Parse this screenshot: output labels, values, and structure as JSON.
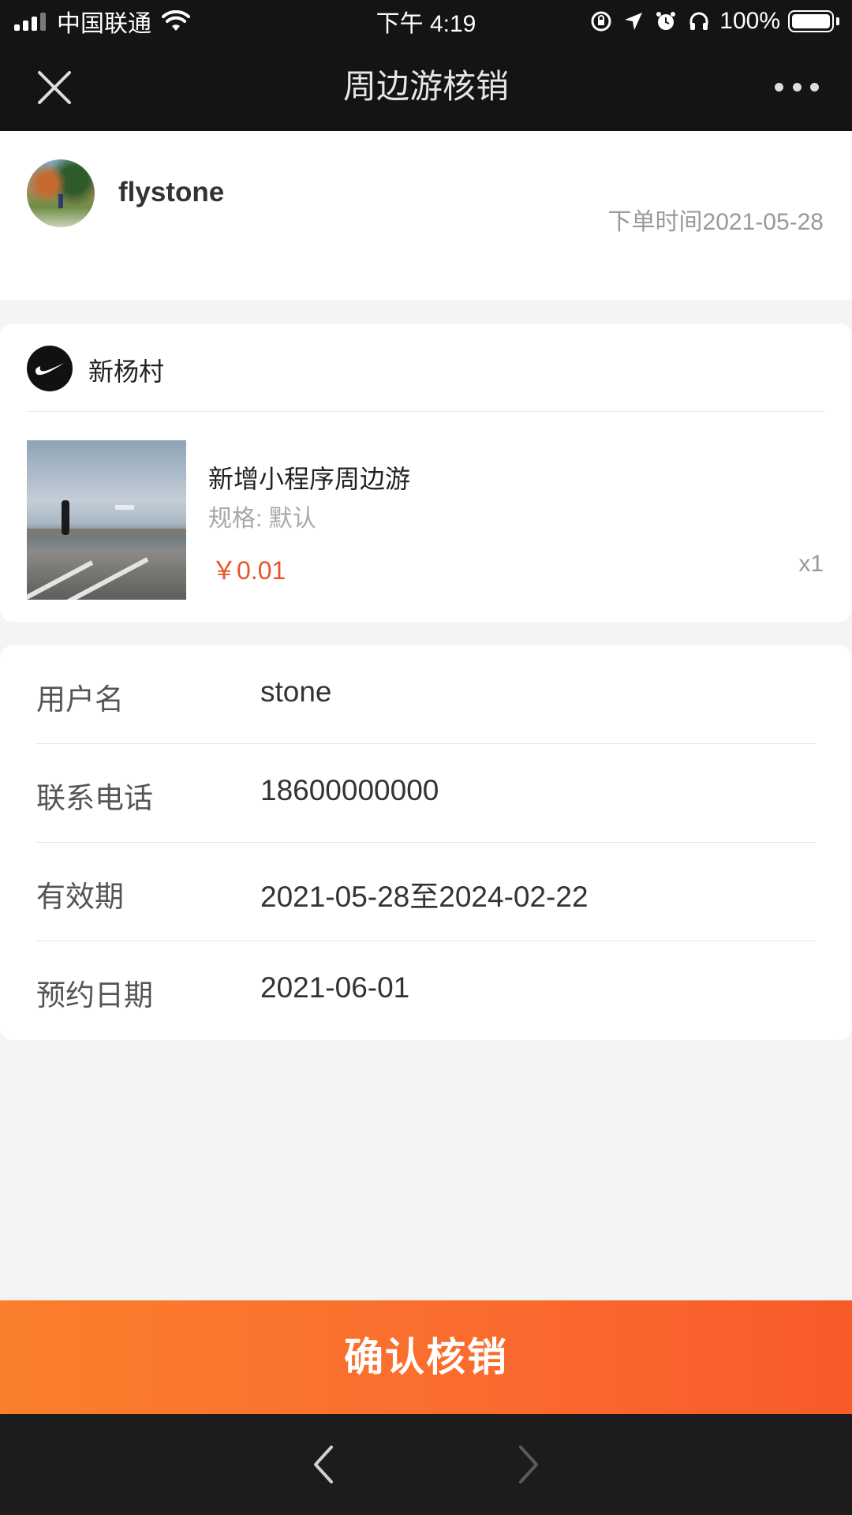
{
  "status_bar": {
    "carrier": "中国联通",
    "time": "下午 4:19",
    "battery": "100%",
    "battery_level": 1.0
  },
  "nav": {
    "title": "周边游核销",
    "close_icon": "close-icon",
    "more_icon": "more-dots-icon"
  },
  "user": {
    "name": "flystone",
    "order_time": "下单时间2021-05-28"
  },
  "shop": {
    "name": "新杨村",
    "logo_icon": "swoosh-logo-icon"
  },
  "product": {
    "name": "新增小程序周边游",
    "spec": "规格: 默认",
    "price": "￥0.01",
    "quantity": "x1"
  },
  "info": {
    "rows": [
      {
        "label": "用户名",
        "value": "stone"
      },
      {
        "label": "联系电话",
        "value": "18600000000"
      },
      {
        "label": "有效期",
        "value": "2021-05-28至2024-02-22"
      },
      {
        "label": "预约日期",
        "value": "2021-06-01"
      }
    ]
  },
  "actions": {
    "confirm_label": "确认核销"
  },
  "colors": {
    "accent": "#fa6a2e",
    "price": "#e8542a",
    "header_bg": "#141414"
  }
}
